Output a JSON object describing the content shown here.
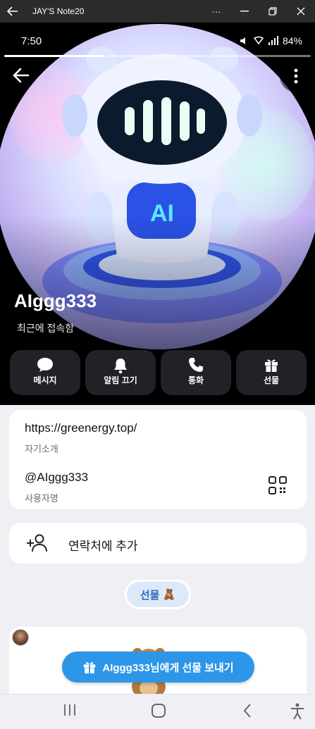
{
  "window": {
    "title": "JAY'S Note20"
  },
  "status_bar": {
    "time": "7:50",
    "indicators": "84%"
  },
  "story_progress": {
    "segments": 3,
    "active": 1
  },
  "profile": {
    "name": "AIggg333",
    "status": "최근에 접속함"
  },
  "actions": [
    {
      "label": "메시지",
      "icon": "chat-icon"
    },
    {
      "label": "알림 끄기",
      "icon": "bell-icon"
    },
    {
      "label": "통화",
      "icon": "phone-icon"
    },
    {
      "label": "선물",
      "icon": "gift-icon"
    }
  ],
  "info": {
    "bio_value": "https://greenergy.top/",
    "bio_label": "자기소개",
    "username_value": "@AIggg333",
    "username_label": "사용자명"
  },
  "add_contact": {
    "label": "연락처에 추가"
  },
  "gifts_section": {
    "label": "선물",
    "emoji": "🧸"
  },
  "send_gift": {
    "label": "AIggg333님에게 선물 보내기"
  },
  "colors": {
    "accent": "#2d96e8",
    "header_bg": "#000000",
    "page_bg": "#f0eff4"
  }
}
